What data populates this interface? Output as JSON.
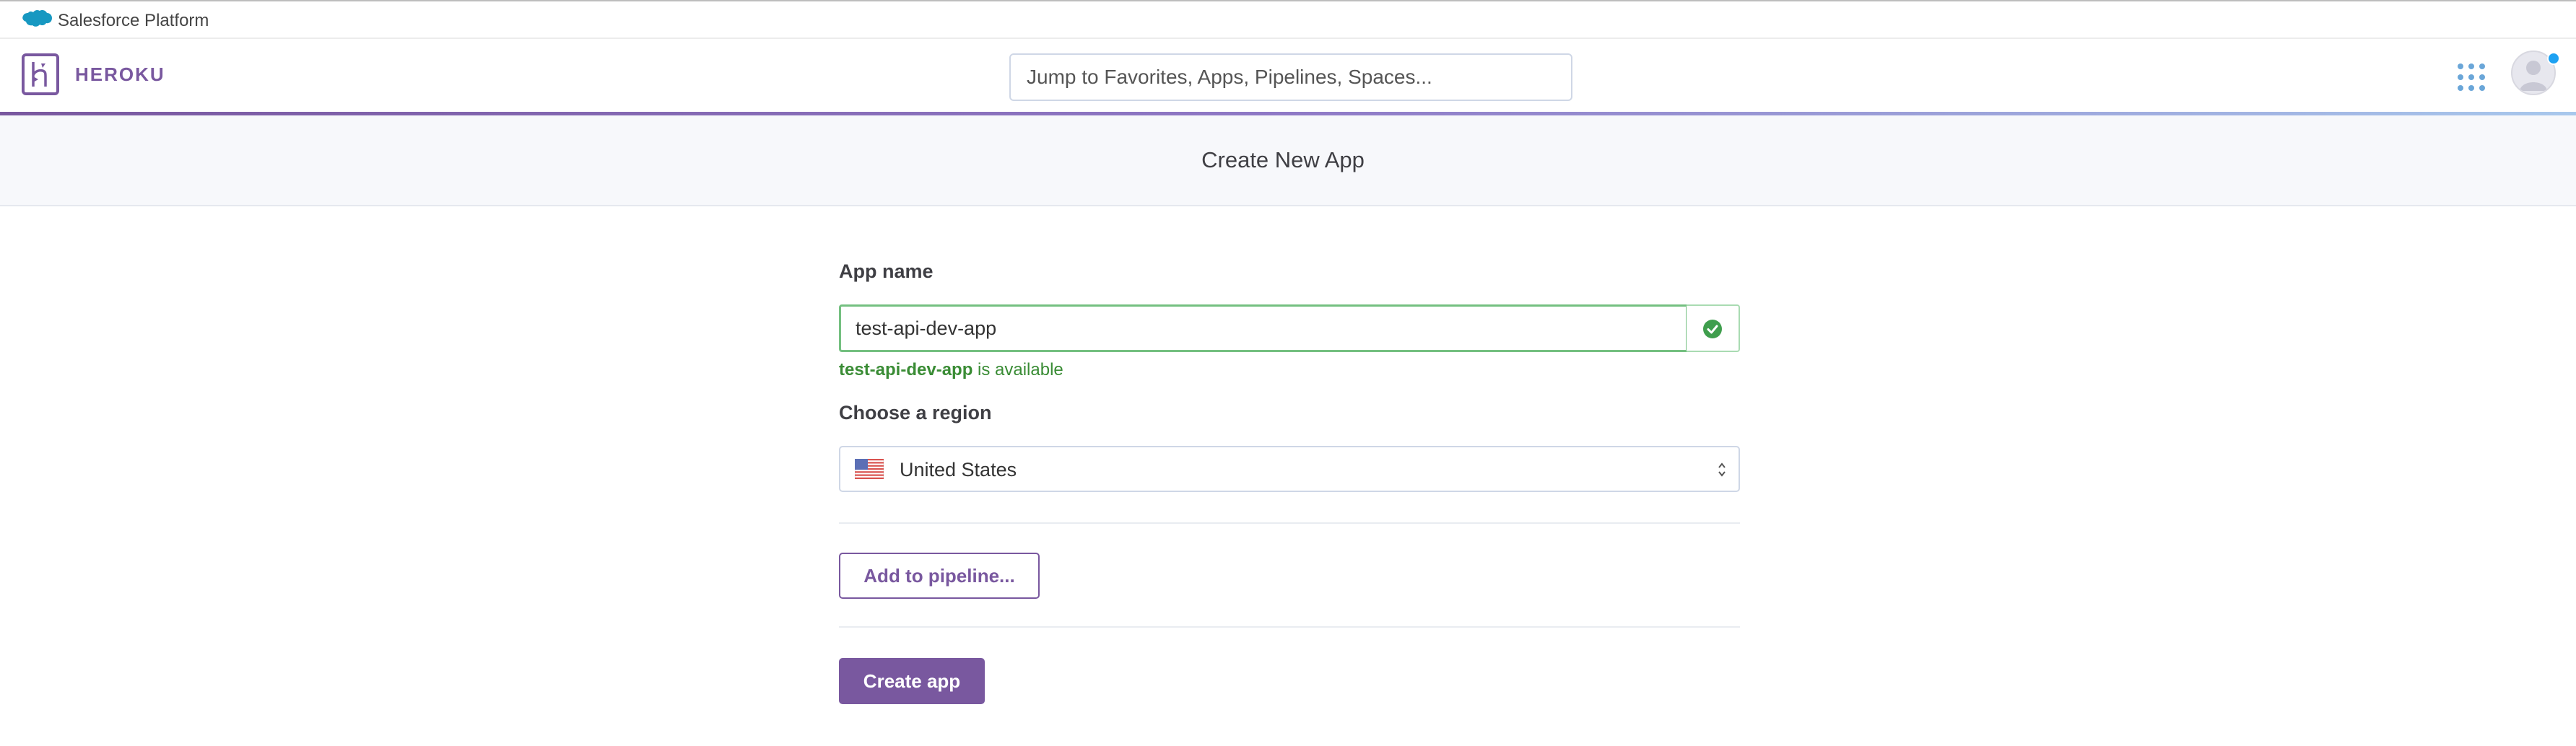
{
  "platform_bar": {
    "label": "Salesforce Platform"
  },
  "header": {
    "brand": "HEROKU",
    "search_placeholder": "Jump to Favorites, Apps, Pipelines, Spaces..."
  },
  "page": {
    "title": "Create New App"
  },
  "form": {
    "app_name_label": "App name",
    "app_name_value": "test-api-dev-app",
    "availability_name": "test-api-dev-app",
    "availability_suffix": " is available",
    "region_label": "Choose a region",
    "region_value": "United States",
    "pipeline_button": "Add to pipeline...",
    "create_button": "Create app"
  },
  "colors": {
    "brand_purple": "#79589f",
    "success_green": "#3f9e4d",
    "salesforce_blue": "#1798c1"
  }
}
